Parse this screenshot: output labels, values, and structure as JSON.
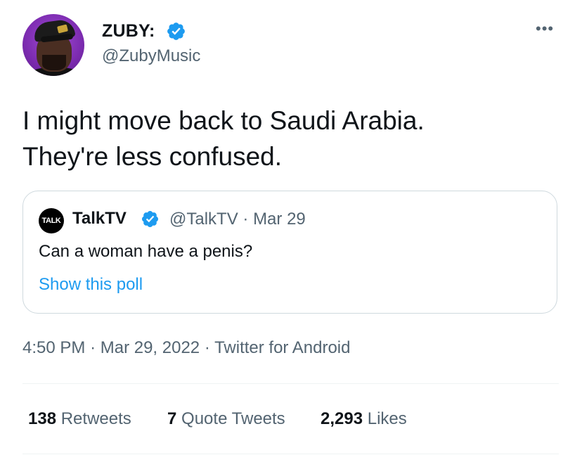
{
  "author": {
    "name": "ZUBY:",
    "handle": "@ZubyMusic",
    "verified": true,
    "avatar_icon": "profile-photo"
  },
  "tweet": {
    "line1": "I might move back to Saudi Arabia.",
    "line2": "They're less confused."
  },
  "quoted": {
    "logo_text": "TALK",
    "name": "TalkTV",
    "handle": "@TalkTV",
    "separator": "·",
    "date": "Mar 29",
    "text": "Can a woman have a penis?",
    "poll_link": "Show this poll"
  },
  "meta": {
    "time": "4:50 PM",
    "sep1": "·",
    "date": "Mar 29, 2022",
    "sep2": "·",
    "source": "Twitter for Android"
  },
  "stats": {
    "retweets_count": "138",
    "retweets_label": "Retweets",
    "quotes_count": "7",
    "quotes_label": "Quote Tweets",
    "likes_count": "2,293",
    "likes_label": "Likes"
  },
  "more_icon": "•••",
  "colors": {
    "accent": "#1d9bf0",
    "secondary_text": "#536471",
    "border": "#cfd9de"
  }
}
